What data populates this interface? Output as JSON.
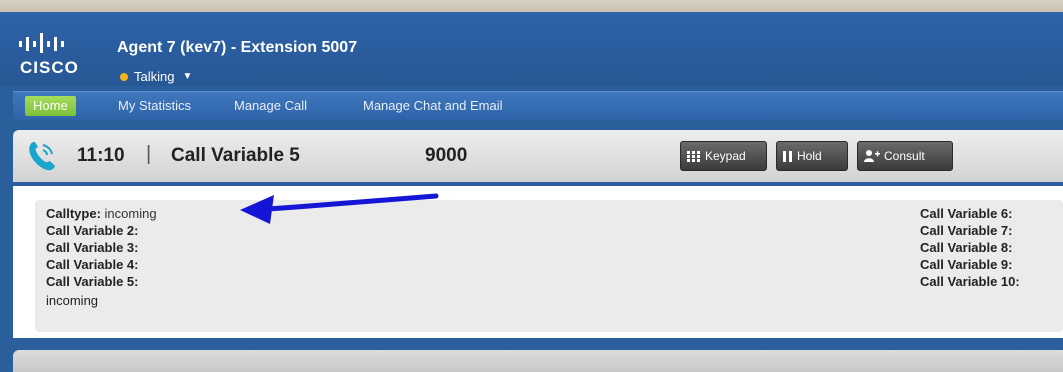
{
  "header": {
    "logo_text": "CISCO",
    "agent_title": "Agent 7 (kev7) - Extension 5007",
    "status": "Talking",
    "status_color": "#f4b41a"
  },
  "nav": {
    "items": [
      {
        "label": "Home",
        "active": true
      },
      {
        "label": "My Statistics",
        "active": false
      },
      {
        "label": "Manage Call",
        "active": false
      },
      {
        "label": "Manage Chat and Email",
        "active": false
      }
    ]
  },
  "call": {
    "icon": "phone-icon",
    "timer": "11:10",
    "separator": "|",
    "variable": "Call Variable 5",
    "number": "9000",
    "buttons": {
      "keypad": "Keypad",
      "hold": "Hold",
      "consult": "Consult"
    }
  },
  "variables": {
    "left": [
      {
        "label": "Calltype:",
        "value": "incoming"
      },
      {
        "label": "Call Variable 2:",
        "value": ""
      },
      {
        "label": "Call Variable 3:",
        "value": ""
      },
      {
        "label": "Call Variable 4:",
        "value": ""
      },
      {
        "label": "Call Variable 5:",
        "value": ""
      }
    ],
    "left_extra": "incoming",
    "right": [
      {
        "label": "Call Variable 6:"
      },
      {
        "label": "Call Variable 7:"
      },
      {
        "label": "Call Variable 8:"
      },
      {
        "label": "Call Variable 9:"
      },
      {
        "label": "Call Variable 10:"
      }
    ]
  },
  "annotation": {
    "arrow_color": "#1515d6"
  }
}
